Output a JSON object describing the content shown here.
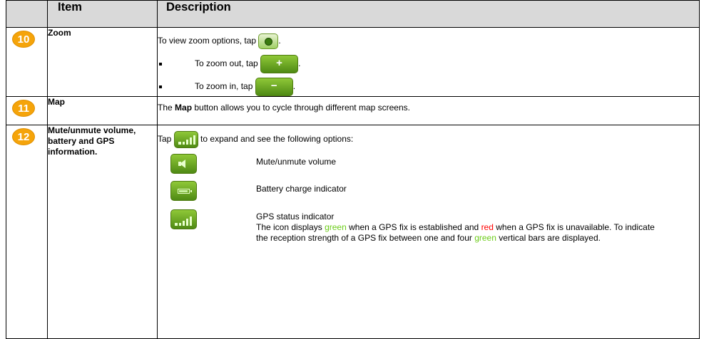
{
  "header": {
    "number": "",
    "item": "Item",
    "description": "Description"
  },
  "colors": {
    "badge": "#f5a40a",
    "header_bg": "#d9d9d9",
    "button_green": "#6aa624",
    "green_text": "#6ccc19",
    "red_text": "#ff0000"
  },
  "rows": [
    {
      "number": "10",
      "item": "Zoom",
      "intro_before": "To view zoom options, tap",
      "intro_after": ".",
      "intro_icon": "zoom-magnifier-icon",
      "bullets": [
        {
          "before": "To zoom out, tap",
          "after": ".",
          "icon": "plus-icon",
          "symbol": "+"
        },
        {
          "before": "To zoom in, tap",
          "after": ".",
          "icon": "minus-icon",
          "symbol": "−"
        }
      ]
    },
    {
      "number": "11",
      "item": "Map",
      "desc_prefix": "The",
      "desc_bold": "Map",
      "desc_suffix": "button allows you to cycle through different map screens."
    },
    {
      "number": "12",
      "item": "Mute/unmute volume, battery and GPS information.",
      "tap_before": "Tap",
      "tap_after": "to expand and see the following options:",
      "tap_icon": "gps-signal-icon",
      "options": [
        {
          "icon": "speaker-icon",
          "label": "Mute/unmute volume"
        },
        {
          "icon": "battery-icon",
          "label": "Battery charge indicator"
        },
        {
          "icon": "gps-signal-icon",
          "label": "GPS status indicator",
          "detail_1": "The icon displays",
          "detail_green": "green",
          "detail_2": "when a GPS fix is established and",
          "detail_red": "red",
          "detail_3": "when a GPS fix is unavailable. To indicate the reception strength of a GPS fix between one and four",
          "detail_green_2": "green",
          "detail_4": "vertical bars are displayed."
        }
      ]
    }
  ]
}
